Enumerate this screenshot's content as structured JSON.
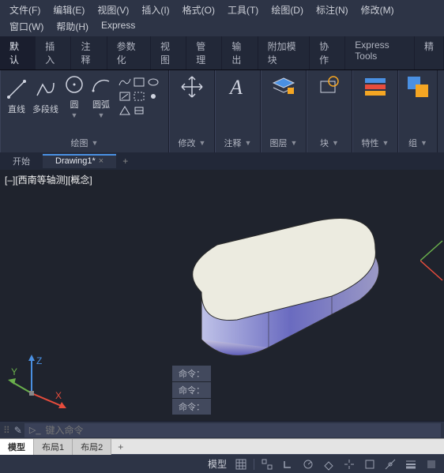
{
  "menu": [
    "文件(F)",
    "编辑(E)",
    "视图(V)",
    "插入(I)",
    "格式(O)",
    "工具(T)",
    "绘图(D)",
    "标注(N)",
    "修改(M)",
    "窗口(W)",
    "帮助(H)",
    "Express"
  ],
  "ribbon_tabs": [
    "默认",
    "插入",
    "注释",
    "参数化",
    "视图",
    "管理",
    "输出",
    "附加模块",
    "协作",
    "Express Tools",
    "精"
  ],
  "draw_panel": {
    "title": "绘图",
    "items": [
      "直线",
      "多段线",
      "圆",
      "圆弧"
    ]
  },
  "panels": [
    "修改",
    "注释",
    "图层",
    "块",
    "特性",
    "组"
  ],
  "file_tabs": {
    "start": "开始",
    "active": "Drawing1*",
    "close": "×",
    "add": "+"
  },
  "view_label": "[–][西南等轴测][概念]",
  "axes": {
    "x": "X",
    "y": "Y",
    "z": "Z"
  },
  "cmd_history": [
    "命令：",
    "命令：",
    "命令："
  ],
  "cmd_placeholder": "键入命令",
  "layout_tabs": {
    "model": "模型",
    "l1": "布局1",
    "l2": "布局2",
    "add": "+"
  },
  "status": {
    "model": "模型"
  }
}
